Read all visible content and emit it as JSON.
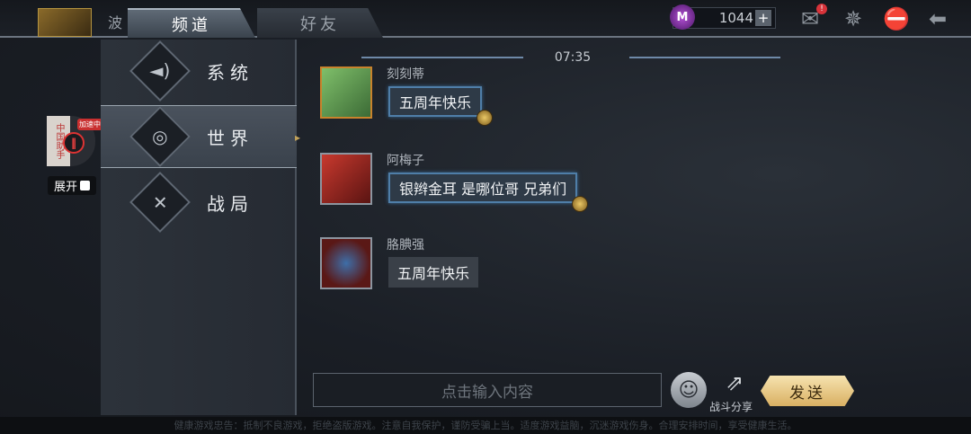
{
  "topbar": {
    "partial_text": "波",
    "tabs": [
      {
        "label": "频道",
        "active": true
      },
      {
        "label": "好友",
        "active": false
      }
    ],
    "currency_value": "1044",
    "currency_icon": "M",
    "mail_badge": "!"
  },
  "helper": {
    "card_text": "中国助手",
    "badge": "加速中",
    "expand_label": "展开"
  },
  "sidebar": {
    "items": [
      {
        "label": "系统",
        "icon": "speaker-icon",
        "active": false
      },
      {
        "label": "世界",
        "icon": "world-chat-icon",
        "active": true
      },
      {
        "label": "战局",
        "icon": "crossed-swords-icon",
        "active": false
      }
    ]
  },
  "chat": {
    "time": "07:35",
    "messages": [
      {
        "name": "刻刻蒂",
        "text": "五周年快乐",
        "style": "fancy"
      },
      {
        "name": "阿梅子",
        "text": "银辫金耳 是哪位哥 兄弟们",
        "style": "fancy"
      },
      {
        "name": "胳腆强",
        "text": "五周年快乐",
        "style": "plain"
      }
    ]
  },
  "input": {
    "placeholder": "点击输入内容",
    "share_label": "战斗分享",
    "send_label": "发送"
  },
  "footer": {
    "note": "健康游戏忠告：抵制不良游戏，拒绝盗版游戏。注意自我保护，谨防受骗上当。适度游戏益脑，沉迷游戏伤身。合理安排时间，享受健康生活。"
  },
  "colors": {
    "accent_gold": "#d9b062",
    "bubble_border": "#4f7ea8",
    "currency_purple": "#b552d6"
  }
}
